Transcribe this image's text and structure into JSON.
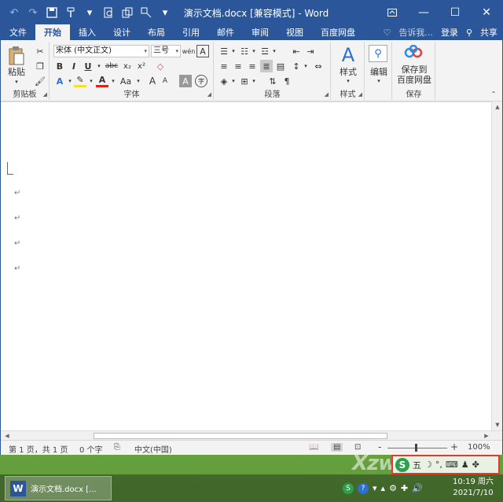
{
  "window": {
    "title": "演示文档.docx [兼容模式] - Word"
  },
  "qat": {
    "undo": "↶",
    "redo": "↷",
    "save": "💾",
    "more": "▾"
  },
  "tabs": [
    "文件",
    "开始",
    "插入",
    "设计",
    "布局",
    "引用",
    "邮件",
    "审阅",
    "视图",
    "百度网盘"
  ],
  "tab_right": {
    "tell": "告诉我...",
    "login": "登录",
    "share": "共享"
  },
  "ribbon": {
    "clipboard": {
      "label": "剪贴板",
      "paste": "粘贴"
    },
    "font": {
      "label": "字体",
      "font_name": "宋体 (中文正文)",
      "font_size": "三号",
      "bold": "B",
      "italic": "I",
      "underline": "U",
      "strike": "abc",
      "sub": "x₂",
      "sup": "x²",
      "grow": "A",
      "shrink": "A",
      "case": "Aa",
      "pinyin": "wén",
      "border_char": "A",
      "shade_char": "A",
      "enclose": "字"
    },
    "paragraph": {
      "label": "段落"
    },
    "styles": {
      "label": "样式",
      "btn": "样式"
    },
    "editing": {
      "btn": "编辑"
    },
    "save": {
      "label": "保存",
      "btn_line1": "保存到",
      "btn_line2": "百度网盘"
    }
  },
  "statusbar": {
    "page": "第 1 页，共 1 页",
    "words": "0 个字",
    "lang": "中文(中国)",
    "zoom_minus": "-",
    "zoom_plus": "+",
    "zoom": "100%",
    "zoom_level": 0.5
  },
  "ime": {
    "logo": "S",
    "mode": "五",
    "moon": "☽",
    "punct": "°,",
    "keyboard": "⌨",
    "person": "♟",
    "grid": "✤"
  },
  "taskbar": {
    "task_label": "演示文档.docx [...",
    "time": "10:19 周六",
    "date": "2021/7/10"
  },
  "watermark": "Xzws"
}
